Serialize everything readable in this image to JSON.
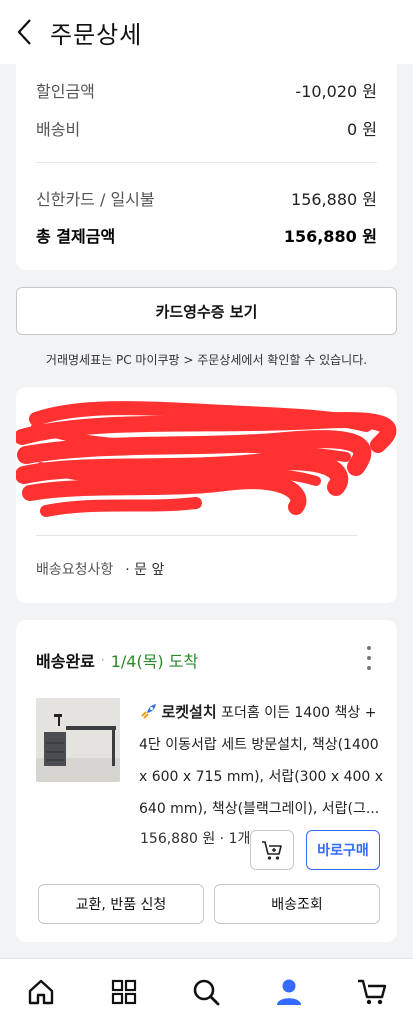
{
  "header": {
    "title": "주문상세"
  },
  "summary": {
    "discount_label": "할인금액",
    "discount_value": "-10,020 원",
    "shipping_label": "배송비",
    "shipping_value": "0 원",
    "card_label": "신한카드 / 일시불",
    "card_value": "156,880 원",
    "total_label": "총 결제금액",
    "total_value": "156,880 원"
  },
  "receipt_button": "카드영수증 보기",
  "notice": "거래명세표는 PC 마이쿠팡 > 주문상세에서 확인할 수 있습니다.",
  "address": {
    "request_label": "배송요청사항",
    "request_value": "· 문 앞"
  },
  "order": {
    "status": "배송완료",
    "date": "1/4(목) 도착",
    "badge": "로켓설치",
    "product_name": "포더홈 이든 1400 책상 + 4단 이동서랍 세트 방문설치, 책상(1400 x 600 x 715 mm), 서랍(300 x 400 x 640 mm), 책상(블랙그레이), 서랍(그...",
    "price_qty": "156,880 원 · 1개",
    "buy_now": "바로구매",
    "exchange_button": "교환, 반품 신청",
    "tracking_button": "배송조회"
  },
  "colors": {
    "accent": "#346aff",
    "delivered": "#2a8a2a",
    "redaction": "#ff3131"
  },
  "nav": {
    "icons": [
      "home-icon",
      "category-grid-icon",
      "search-icon",
      "mypage-person-icon",
      "cart-icon"
    ]
  }
}
